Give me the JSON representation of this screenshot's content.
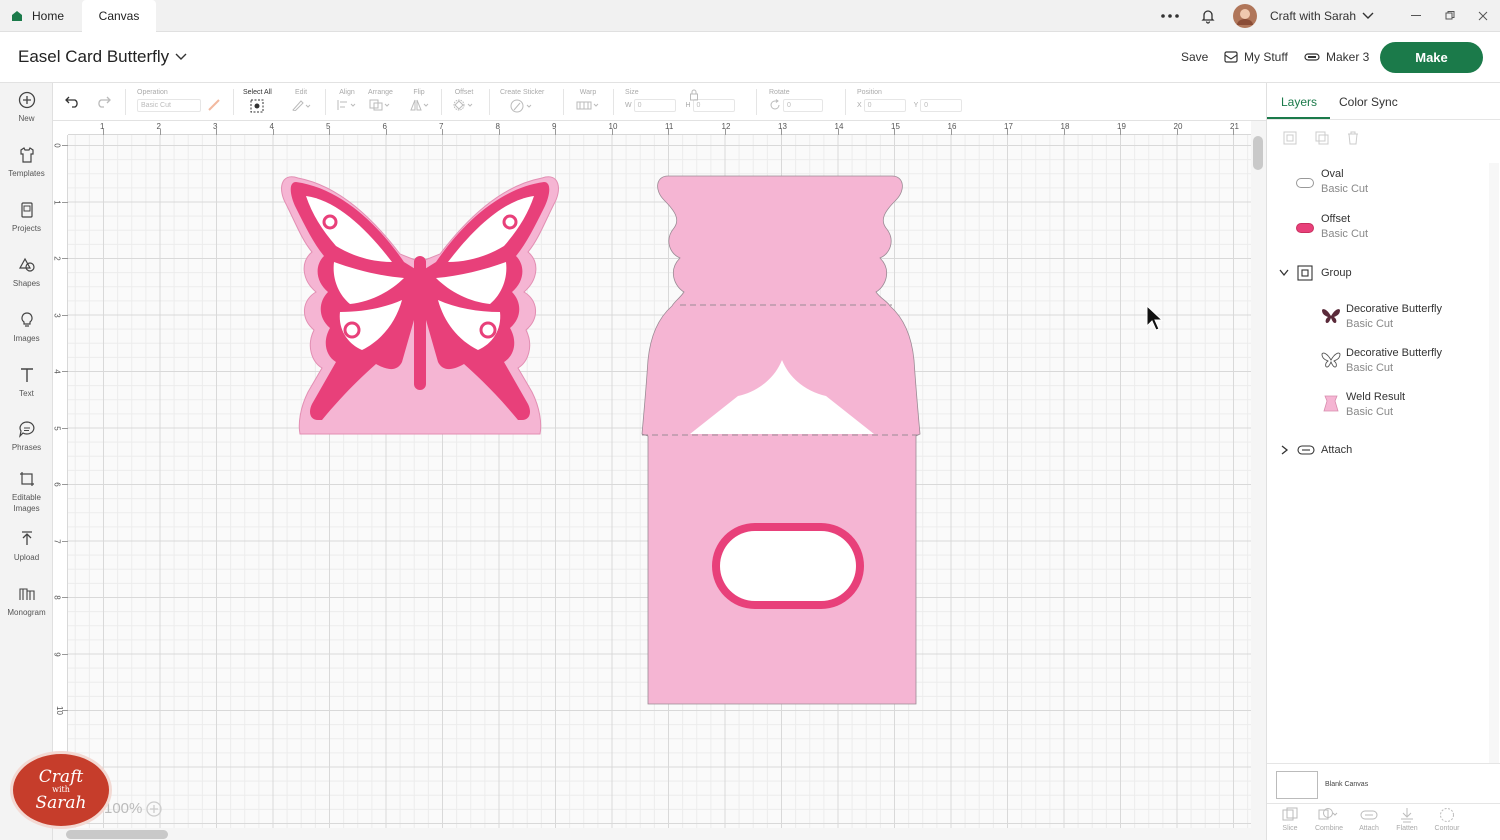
{
  "tabs": {
    "home": "Home",
    "canvas": "Canvas"
  },
  "account": {
    "name": "Craft with Sarah"
  },
  "header": {
    "title": "Easel Card Butterfly",
    "save": "Save",
    "my_stuff": "My Stuff",
    "machine": "Maker 3",
    "make": "Make"
  },
  "sidebar": {
    "items": [
      {
        "label": "New",
        "icon": "plus-circle-icon"
      },
      {
        "label": "Templates",
        "icon": "shirt-icon"
      },
      {
        "label": "Projects",
        "icon": "projects-icon"
      },
      {
        "label": "Shapes",
        "icon": "shapes-icon"
      },
      {
        "label": "Images",
        "icon": "lightbulb-icon"
      },
      {
        "label": "Text",
        "icon": "text-icon"
      },
      {
        "label": "Phrases",
        "icon": "speech-bubble-icon"
      },
      {
        "label": "Editable Images",
        "icon": "editable-images-icon"
      },
      {
        "label": "Upload",
        "icon": "upload-icon"
      },
      {
        "label": "Monogram",
        "icon": "monogram-icon"
      }
    ]
  },
  "toolbar": {
    "operation": "Operation",
    "operation_value": "Basic Cut",
    "select_all": "Select All",
    "edit": "Edit",
    "align": "Align",
    "arrange": "Arrange",
    "flip": "Flip",
    "offset": "Offset",
    "create_sticker": "Create Sticker",
    "warp": "Warp",
    "size": "Size",
    "w": "W",
    "w_value": "0",
    "h": "H",
    "h_value": "0",
    "rotate": "Rotate",
    "rotate_value": "0",
    "position": "Position",
    "x": "X",
    "x_value": "0",
    "y": "Y",
    "y_value": "0"
  },
  "rulers": {
    "top": [
      "1",
      "2",
      "3",
      "4",
      "5",
      "6",
      "7",
      "8",
      "9",
      "10",
      "11",
      "12",
      "13",
      "14",
      "15",
      "16",
      "17",
      "18",
      "19",
      "20",
      "21"
    ],
    "left": [
      "0",
      "1",
      "2",
      "3",
      "4",
      "5",
      "6",
      "7",
      "8",
      "9",
      "10"
    ]
  },
  "panel": {
    "tab_layers": "Layers",
    "tab_color_sync": "Color Sync",
    "layers": [
      {
        "name": "Oval",
        "op": "Basic Cut"
      },
      {
        "name": "Offset",
        "op": "Basic Cut"
      },
      {
        "name": "Group"
      },
      {
        "name": "Decorative Butterfly",
        "op": "Basic Cut"
      },
      {
        "name": "Decorative Butterfly",
        "op": "Basic Cut"
      },
      {
        "name": "Weld Result",
        "op": "Basic Cut"
      },
      {
        "name": "Attach"
      }
    ],
    "blank_canvas": "Blank Canvas",
    "bottom_actions": [
      "Slice",
      "Combine",
      "Attach",
      "Flatten",
      "Contour"
    ]
  },
  "colors": {
    "accent": "#1b7a4a",
    "light_pink": "#f5b5d3",
    "hot_pink": "#e8407a"
  },
  "zoom": "100%",
  "watermark": {
    "line1": "Craft",
    "line2": "with",
    "line3": "Sarah"
  }
}
